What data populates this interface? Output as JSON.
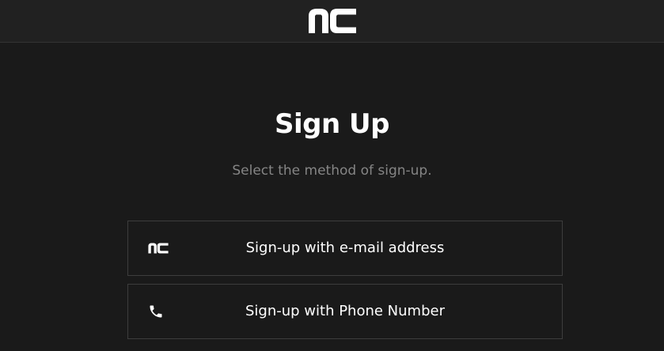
{
  "header": {
    "logo_icon": "nc-logo-icon"
  },
  "main": {
    "title": "Sign Up",
    "subtitle": "Select the method of sign-up."
  },
  "options": [
    {
      "label": "Sign-up with e-mail address",
      "icon": "nc-logo-icon"
    },
    {
      "label": "Sign-up with Phone Number",
      "icon": "phone-icon"
    }
  ],
  "colors": {
    "background": "#1a1a1a",
    "header_background": "#212121",
    "text": "#ffffff",
    "subtitle_text": "#858585",
    "border": "#3d3d3d"
  }
}
